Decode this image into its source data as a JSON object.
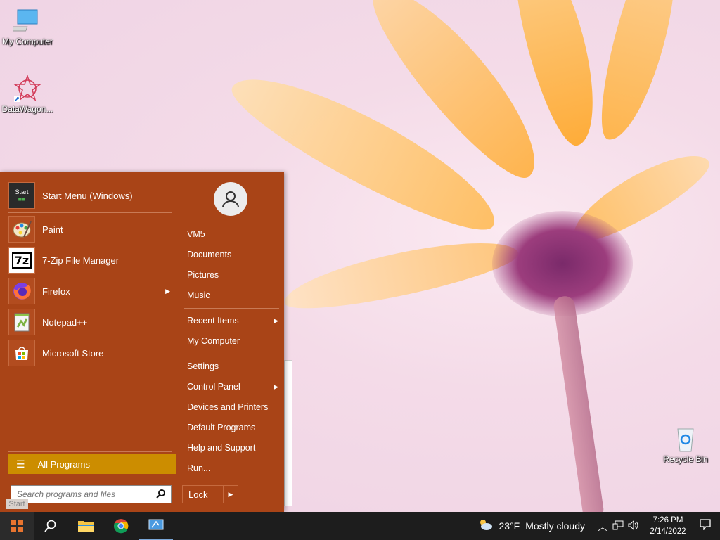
{
  "desktop": {
    "icons": [
      {
        "label": "My Computer",
        "icon": "computer-icon"
      },
      {
        "label": "DataWagon...",
        "icon": "datawagon-icon"
      },
      {
        "label": "Recycle Bin",
        "icon": "recycle-bin-icon"
      }
    ]
  },
  "start_menu": {
    "pinned": [
      {
        "label": "Start Menu (Windows)",
        "icon": "start-menu-icon"
      }
    ],
    "programs": [
      {
        "label": "Paint",
        "icon": "paint-icon",
        "submenu": false
      },
      {
        "label": "7-Zip File Manager",
        "icon": "7zip-icon",
        "submenu": false
      },
      {
        "label": "Firefox",
        "icon": "firefox-icon",
        "submenu": true
      },
      {
        "label": "Notepad++",
        "icon": "notepadpp-icon",
        "submenu": false
      },
      {
        "label": "Microsoft Store",
        "icon": "store-icon",
        "submenu": false
      }
    ],
    "all_programs": "All Programs",
    "search_placeholder": "Search programs and files",
    "right": {
      "user_items": [
        "VM5",
        "Documents",
        "Pictures",
        "Music"
      ],
      "recent_items": "Recent Items",
      "my_computer": "My Computer",
      "settings": "Settings",
      "control_panel": "Control Panel",
      "devices": "Devices and Printers",
      "default_programs": "Default Programs",
      "help": "Help and Support",
      "run": "Run...",
      "lock": "Lock"
    },
    "start_tooltip": "Start"
  },
  "taskbar": {
    "weather_temp": "23°F",
    "weather_desc": "Mostly cloudy",
    "time": "7:26 PM",
    "date": "2/14/2022"
  },
  "colors": {
    "menu_bg": "#a94417",
    "accent": "#cc8d00",
    "taskbar": "#1d1d1d"
  }
}
